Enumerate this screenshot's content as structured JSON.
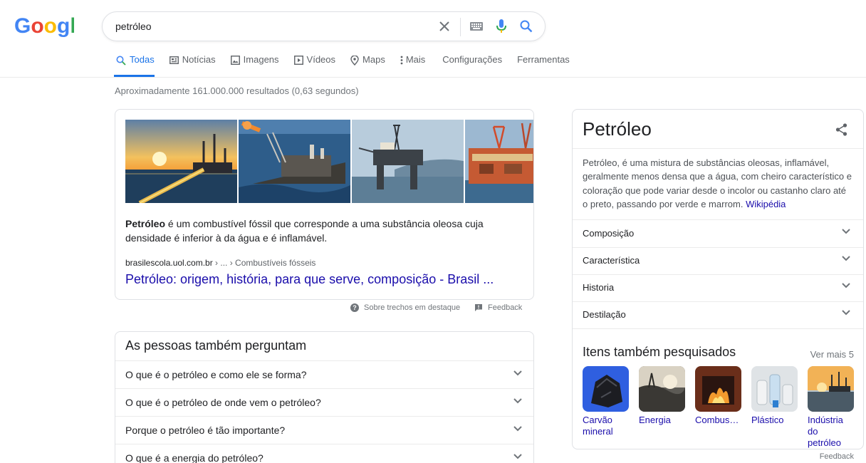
{
  "logo": {
    "text": "Google",
    "colors": [
      "#4285F4",
      "#EA4335",
      "#FBBC05",
      "#4285F4",
      "#34A853",
      "#EA4335"
    ]
  },
  "search": {
    "query": "petróleo",
    "clear_icon": "close-icon",
    "keyboard_icon": "keyboard-icon",
    "mic_icon": "microphone-icon",
    "submit_icon": "search-icon"
  },
  "tabs": [
    {
      "label": "Todas",
      "icon": "search-icon",
      "active": true
    },
    {
      "label": "Notícias",
      "icon": "news-icon"
    },
    {
      "label": "Imagens",
      "icon": "image-icon"
    },
    {
      "label": "Vídeos",
      "icon": "video-icon"
    },
    {
      "label": "Maps",
      "icon": "map-pin-icon"
    },
    {
      "label": "Mais",
      "icon": "more-vert-icon"
    },
    {
      "label": "Configurações"
    },
    {
      "label": "Ferramentas"
    }
  ],
  "result_stats": "Aproximadamente 161.000.000 resultados (0,63 segundos)",
  "featured_snippet": {
    "bold_term": "Petróleo",
    "text": " é um combustível fóssil que corresponde a uma substância oleosa cuja densidade é inferior à da água e é inflamável.",
    "cite_domain": "brasilescola.uol.com.br",
    "cite_path": " › ... › Combustíveis fósseis",
    "link_title": "Petróleo: origem, história, para que serve, composição - Brasil ...",
    "about_label": "Sobre trechos em destaque",
    "feedback_label": "Feedback"
  },
  "people_also_ask": {
    "title": "As pessoas também perguntam",
    "questions": [
      "O que é o petróleo e como ele se forma?",
      "O que é o petróleo de onde vem o petróleo?",
      "Porque o petróleo é tão importante?",
      "O que é a energia do petróleo?"
    ]
  },
  "knowledge_panel": {
    "title": "Petróleo",
    "description": "Petróleo, é uma mistura de substâncias oleosas, inflamável, geralmente menos densa que a água, com cheiro característico e coloração que pode variar desde o incolor ou castanho claro até o preto, passando por verde e marrom. ",
    "source": "Wikipédia",
    "rows": [
      "Composição",
      "Característica",
      "Historia",
      "Destilação"
    ],
    "related_title": "Itens também pesquisados",
    "related_more": "Ver mais 5",
    "related": [
      {
        "label": "Carvão mineral"
      },
      {
        "label": "Energia"
      },
      {
        "label": "Combust…"
      },
      {
        "label": "Plástico"
      },
      {
        "label": "Indústria do petróleo"
      }
    ],
    "feedback_label": "Feedback"
  },
  "colors": {
    "link": "#1a0dab",
    "accent": "#1a73e8",
    "muted": "#70757a"
  }
}
